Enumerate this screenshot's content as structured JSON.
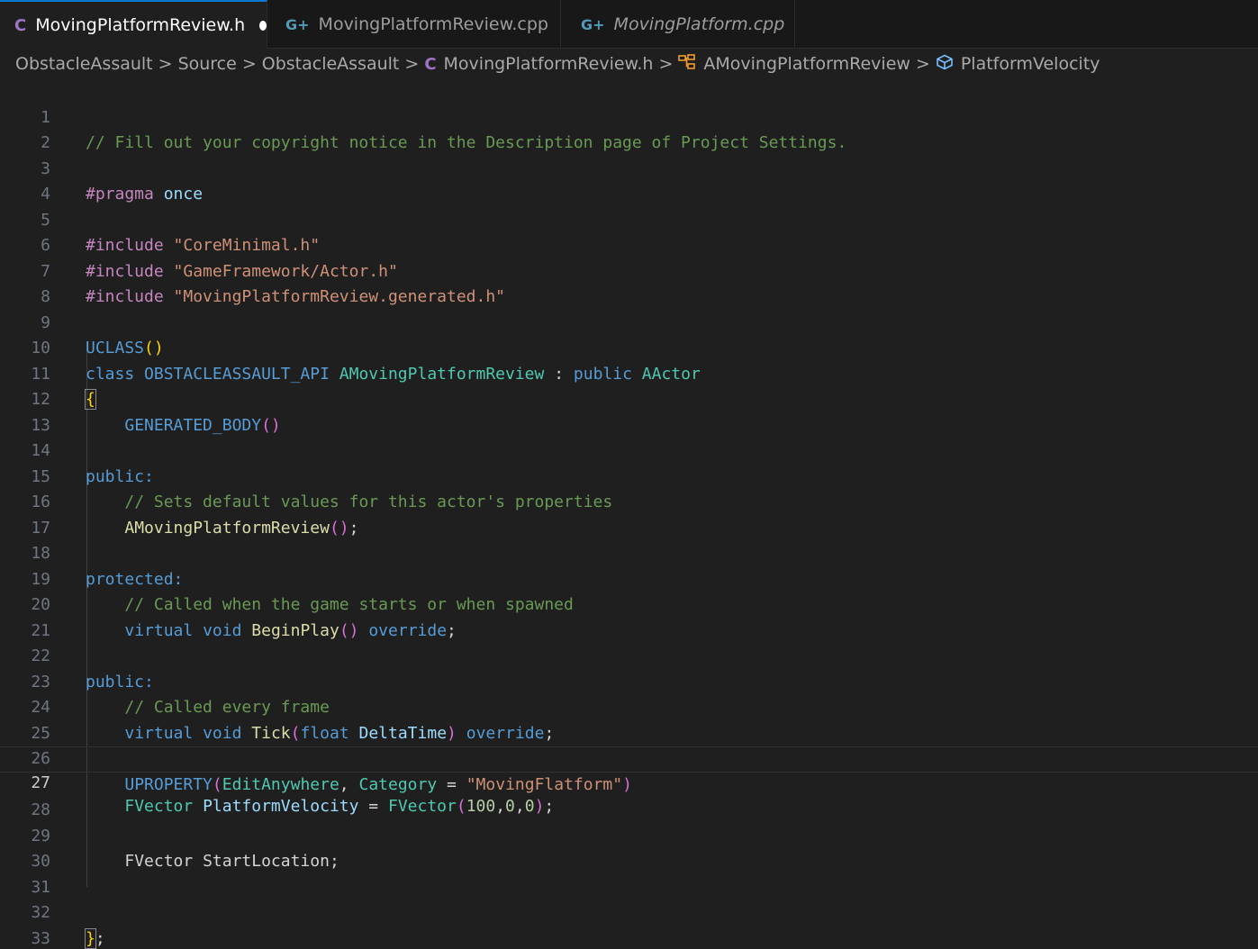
{
  "tabs": [
    {
      "icon": "C",
      "label": "MovingPlatformReview.h",
      "active": true,
      "modified": true,
      "italic": false
    },
    {
      "icon": "G+",
      "label": "MovingPlatformReview.cpp",
      "active": false,
      "modified": false,
      "italic": false
    },
    {
      "icon": "G+",
      "label": "MovingPlatform.cpp",
      "active": false,
      "modified": false,
      "italic": true
    }
  ],
  "breadcrumbs": {
    "items": [
      "ObstacleAssault",
      "Source",
      "ObstacleAssault",
      "MovingPlatformReview.h",
      "AMovingPlatformReview",
      "PlatformVelocity"
    ],
    "separator": ">",
    "file_icon": "C"
  },
  "editor": {
    "current_line": 27,
    "line_numbers": [
      "1",
      "2",
      "3",
      "4",
      "5",
      "6",
      "7",
      "8",
      "9",
      "10",
      "11",
      "12",
      "13",
      "14",
      "15",
      "16",
      "17",
      "18",
      "19",
      "20",
      "21",
      "22",
      "23",
      "24",
      "25",
      "26",
      "27",
      "28",
      "29",
      "30",
      "31",
      "32",
      "33"
    ],
    "code": {
      "l1_comment": "// Fill out your copyright notice in the Description page of Project Settings.",
      "l3_pragma": "#pragma",
      "l3_once": "once",
      "l5_include": "#include",
      "l5_path": "\"CoreMinimal.h\"",
      "l6_include": "#include",
      "l6_path": "\"GameFramework/Actor.h\"",
      "l7_include": "#include",
      "l7_path": "\"MovingPlatformReview.generated.h\"",
      "l9_macro": "UCLASS",
      "l10_class": "class",
      "l10_api": "OBSTACLEASSAULT_API",
      "l10_name": "AMovingPlatformReview",
      "l10_colon": ":",
      "l10_public": "public",
      "l10_base": "AActor",
      "l11_brace": "{",
      "l12_macro": "GENERATED_BODY",
      "l14_access": "public:",
      "l15_comment": "// Sets default values for this actor's properties",
      "l16_ctor": "AMovingPlatformReview",
      "l16_semi": ";",
      "l18_access": "protected:",
      "l19_comment": "// Called when the game starts or when spawned",
      "l20_virtual": "virtual",
      "l20_void": "void",
      "l20_fn": "BeginPlay",
      "l20_override": "override",
      "l20_semi": ";",
      "l22_access": "public:",
      "l23_comment": "// Called every frame",
      "l24_virtual": "virtual",
      "l24_void": "void",
      "l24_fn": "Tick",
      "l24_float": "float",
      "l24_param": "DeltaTime",
      "l24_override": "override",
      "l24_semi": ";",
      "l26_macro": "UPROPERTY",
      "l26_spec": "EditAnywhere",
      "l26_comma": ",",
      "l26_category": "Category",
      "l26_eq": "=",
      "l26_value": "\"MovingFlatform\"",
      "l27_type": "FVector",
      "l27_var": "PlatformVelocity",
      "l27_eq": "=",
      "l27_ctor": "FVector",
      "l27_a": "100",
      "l27_b": "0",
      "l27_c": "0",
      "l27_comma": ",",
      "l27_semi": ";",
      "l29_type": "FVector",
      "l29_var": "StartLocation",
      "l29_semi": ";",
      "l32_brace": "}",
      "l32_semi": ";"
    }
  },
  "colors": {
    "background": "#1f1f1f",
    "tab_bar": "#181818",
    "accent": "#0078d4",
    "keyword": "#569cd6",
    "preprocessor": "#c586c0",
    "string": "#ce9178",
    "comment": "#6a9955",
    "type": "#4ec9b0",
    "function": "#dcdcaa",
    "variable": "#9cdcfe",
    "number": "#b5cea8"
  }
}
